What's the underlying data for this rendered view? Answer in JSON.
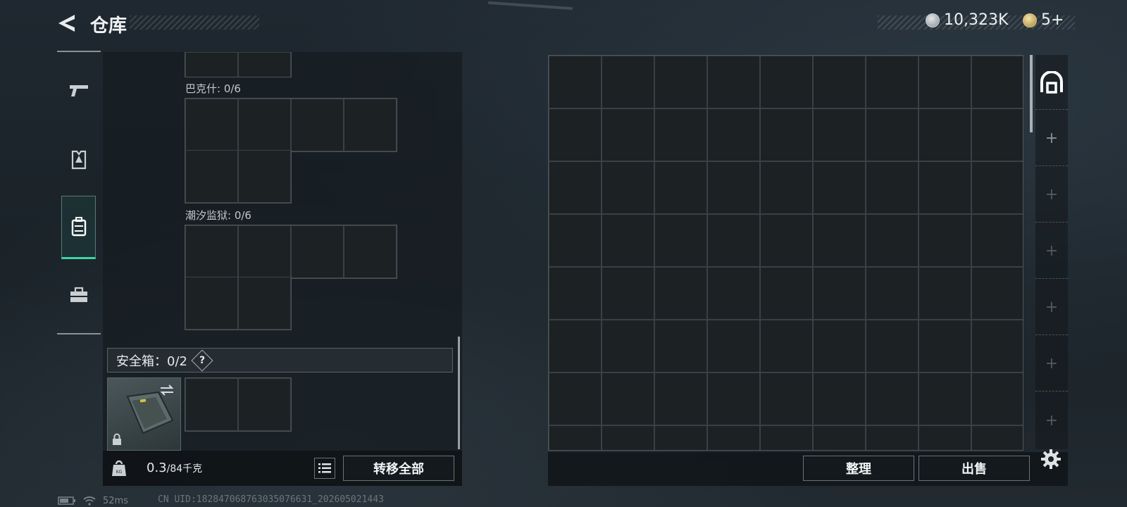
{
  "header": {
    "title": "仓库",
    "currency_silver": "10,323K",
    "currency_gold": "5+"
  },
  "left_nav": {
    "items": [
      {
        "name": "weapon",
        "icon": "pistol-icon"
      },
      {
        "name": "armor",
        "icon": "vest-icon"
      },
      {
        "name": "backpack",
        "icon": "backpack-icon",
        "active": true
      },
      {
        "name": "toolbox",
        "icon": "toolbox-icon"
      }
    ]
  },
  "loadout": {
    "sections": [
      {
        "label": "巴克什: 0/6"
      },
      {
        "label": "潮汐监狱: 0/6"
      }
    ],
    "safebox_label": "安全箱：0/2",
    "help_label": "?",
    "weight_value": "0.3",
    "weight_capacity": "/84千克",
    "transfer_all_label": "转移全部"
  },
  "storage": {
    "columns": 9,
    "sort_label": "整理",
    "sell_label": "出售"
  },
  "right_tabs": {
    "plus_label": "+"
  },
  "status_bar": {
    "ping": "52ms",
    "uid": "CN UID:182847068763035076631_202605021443"
  },
  "colors": {
    "accent": "#3fd3a6",
    "panel": "#1b2023",
    "border": "#4f565b"
  }
}
